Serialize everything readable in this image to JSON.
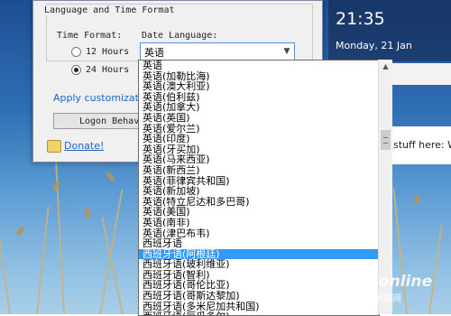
{
  "dialog": {
    "group_title": "Language and Time Format",
    "time_format_label": "Time Format:",
    "option_12": "12 Hours",
    "option_24": "24 Hours",
    "date_language_label": "Date Language:",
    "date_language_value": "英语",
    "apply_link": "Apply customization",
    "logon_button": "Logon Behavi",
    "donate_link": "Donate!"
  },
  "clock": {
    "time": "21:35",
    "date": "Monday, 21 Jan"
  },
  "notification": {
    "text": "stuff here: W"
  },
  "dropdown": {
    "options": [
      "英语",
      "英语(加勒比海)",
      "英语(澳大利亚)",
      "英语(伯利兹)",
      "英语(加拿大)",
      "英语(英国)",
      "英语(爱尔兰)",
      "英语(印度)",
      "英语(牙买加)",
      "英语(马来西亚)",
      "英语(新西兰)",
      "英语(菲律宾共和国)",
      "英语(新加坡)",
      "英语(特立尼达和多巴哥)",
      "英语(美国)",
      "英语(南非)",
      "英语(津巴布韦)",
      "西班牙语",
      "西班牙语(阿根廷)",
      "西班牙语(玻利维亚)",
      "西班牙语(智利)",
      "西班牙语(哥伦比亚)",
      "西班牙语(哥斯达黎加)",
      "西班牙语(多米尼加共和国)",
      "西班牙语(厄瓜多尔)"
    ],
    "selected_index": 18
  },
  "watermark": {
    "brand": "PConline",
    "sub": "太平洋电脑网"
  },
  "colors": {
    "selection": "#3399ff",
    "link": "#1a64c8"
  }
}
